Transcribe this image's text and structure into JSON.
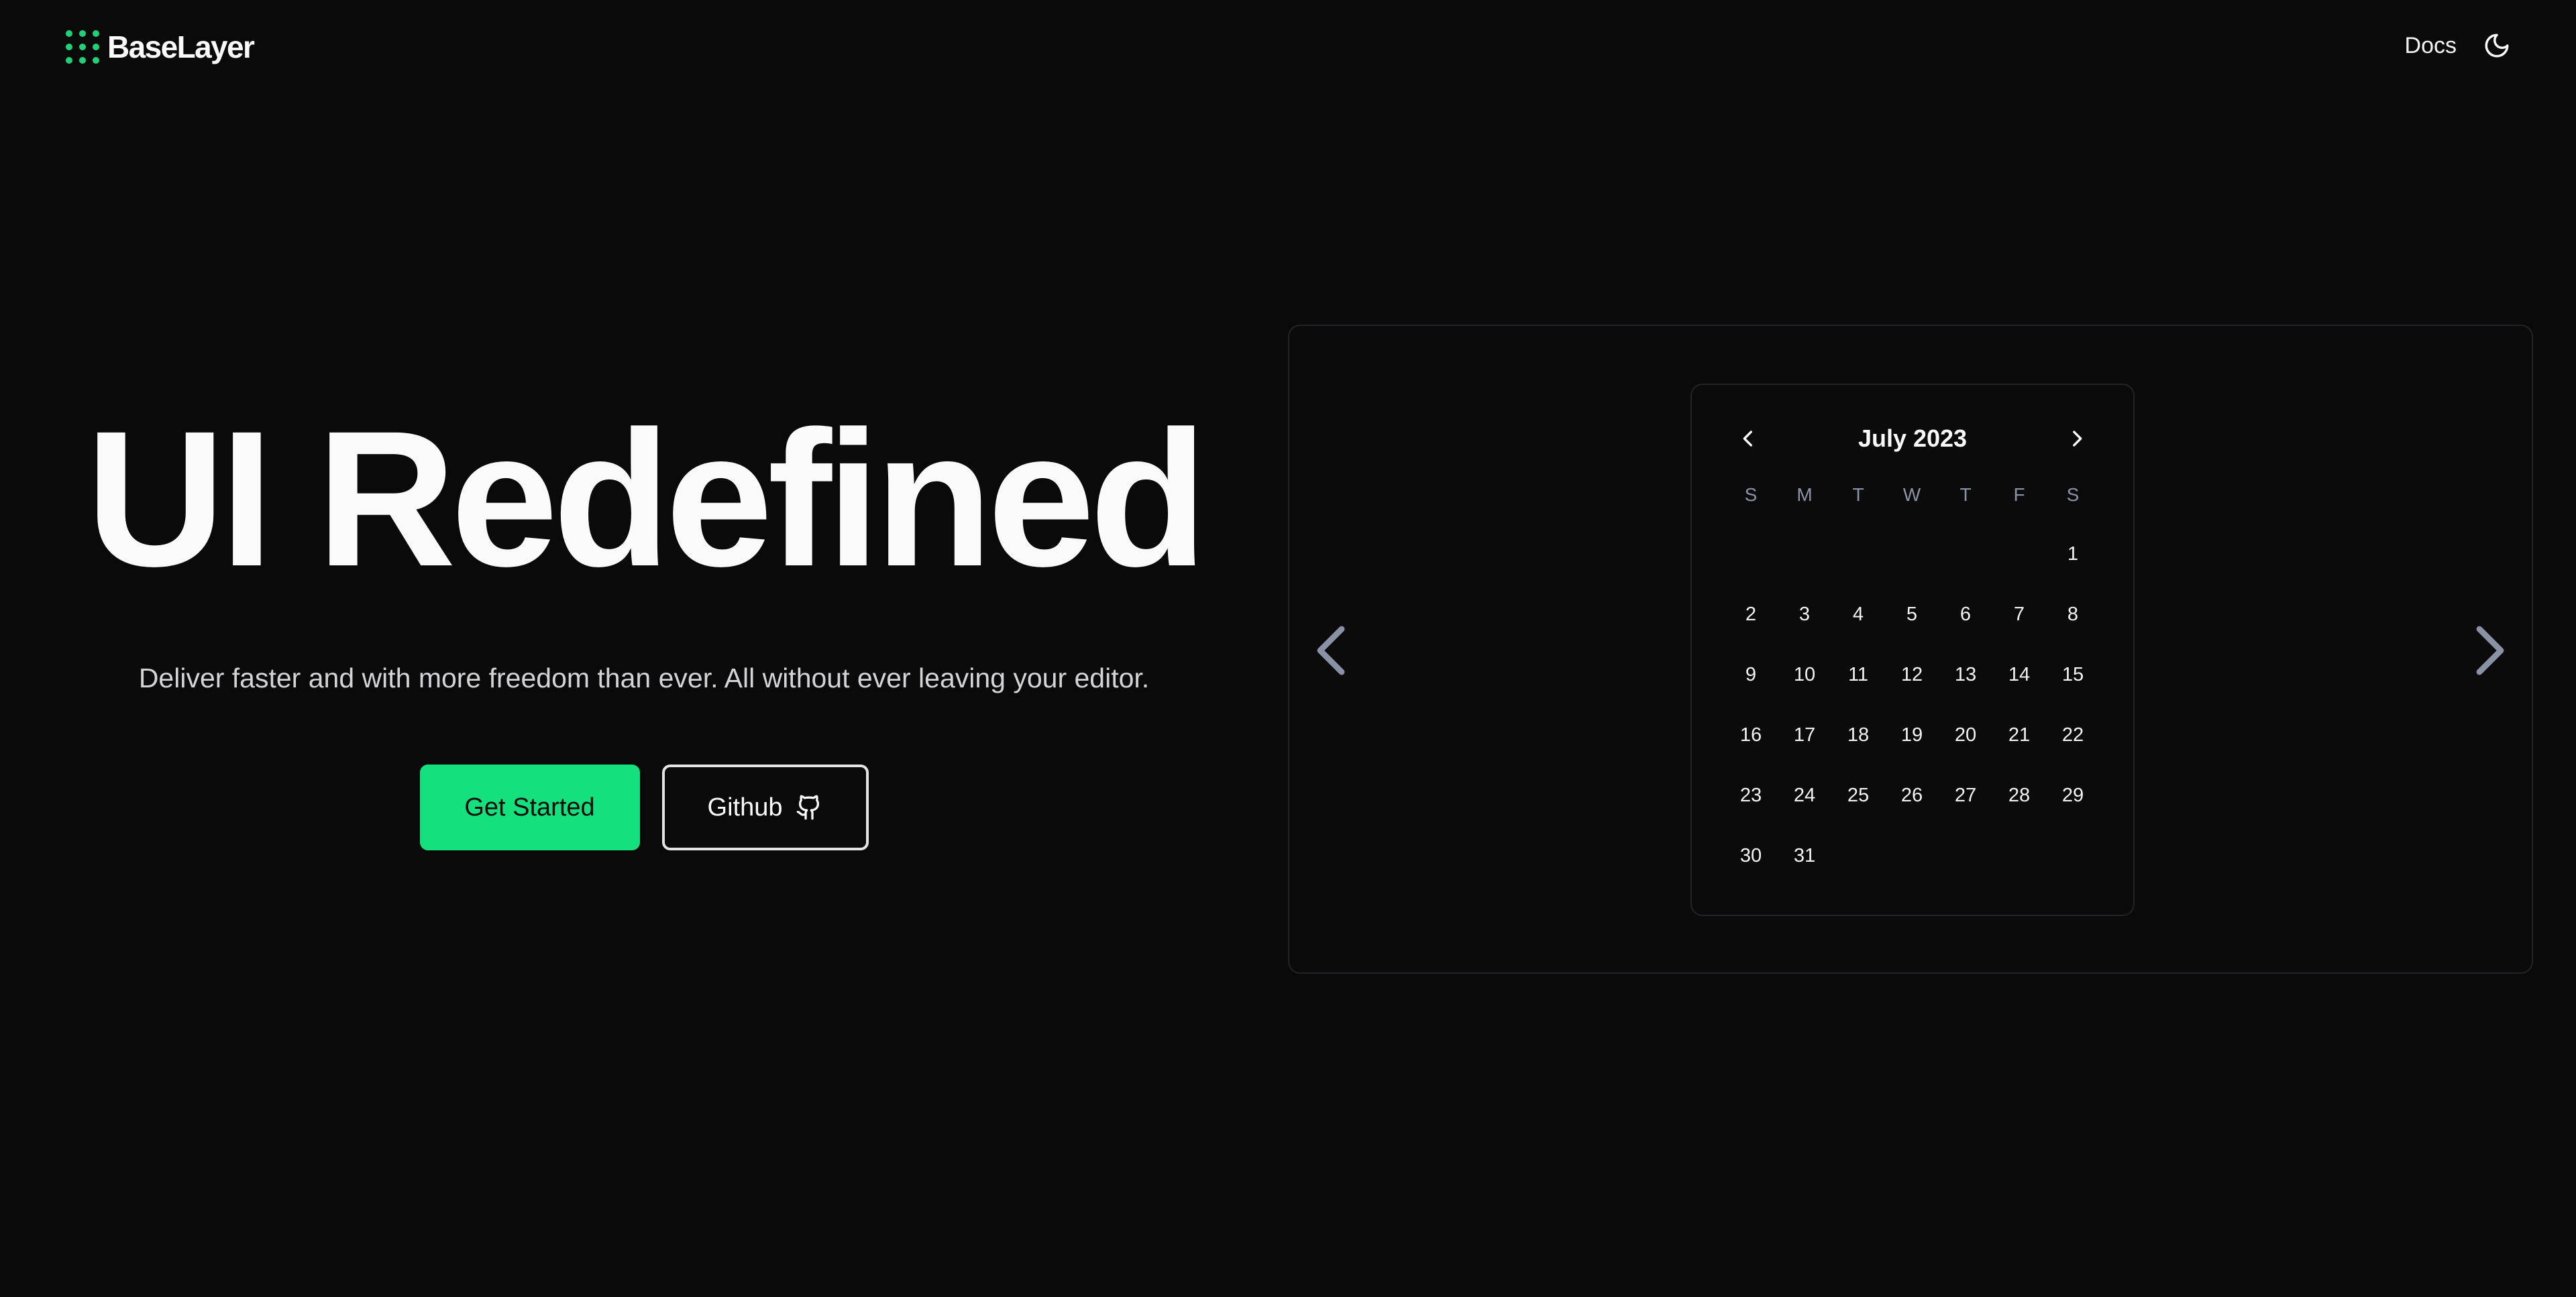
{
  "header": {
    "brand_name": "BaseLayer",
    "brand_color": "#1fd178",
    "logo_icon": "nine-dot-grid-icon",
    "nav": {
      "docs_label": "Docs",
      "theme_icon": "moon-icon"
    }
  },
  "hero": {
    "title": "UI Redefined",
    "subtitle": "Deliver faster and with more freedom than ever. All without ever leaving your editor.",
    "primary_button_label": "Get Started",
    "primary_color": "#14e07d",
    "secondary_button_label": "Github",
    "secondary_icon": "github-icon"
  },
  "showcase": {
    "prev_icon": "chevron-left-icon",
    "next_icon": "chevron-right-icon",
    "calendar": {
      "month_label": "July 2023",
      "prev_month_icon": "chevron-left-icon",
      "next_month_icon": "chevron-right-icon",
      "weekdays": [
        "S",
        "M",
        "T",
        "W",
        "T",
        "F",
        "S"
      ],
      "days": [
        "",
        "",
        "",
        "",
        "",
        "",
        "1",
        "2",
        "3",
        "4",
        "5",
        "6",
        "7",
        "8",
        "9",
        "10",
        "11",
        "12",
        "13",
        "14",
        "15",
        "16",
        "17",
        "18",
        "19",
        "20",
        "21",
        "22",
        "23",
        "24",
        "25",
        "26",
        "27",
        "28",
        "29",
        "30",
        "31"
      ]
    }
  },
  "colors": {
    "background": "#0a0a0a",
    "border": "#232329",
    "muted_text": "#8a93a6"
  }
}
